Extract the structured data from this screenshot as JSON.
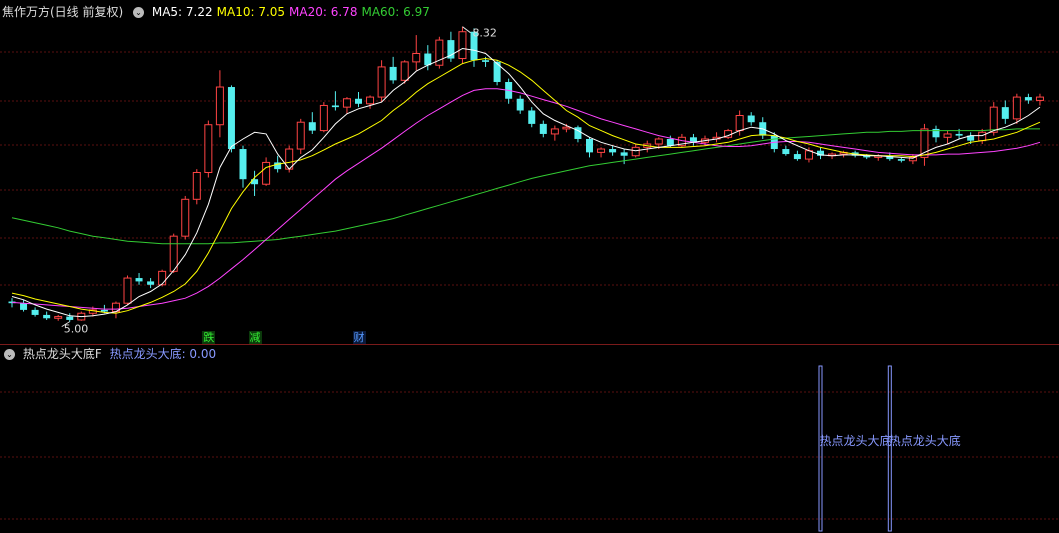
{
  "header": {
    "stock_title": "焦作万方(日线 前复权)",
    "ma_labels": [
      {
        "text": "MA5: 7.22",
        "color": "#ffffff"
      },
      {
        "text": "MA10: 7.05",
        "color": "#ffff00"
      },
      {
        "text": "MA20: 6.78",
        "color": "#ff44ff"
      },
      {
        "text": "MA60: 6.97",
        "color": "#33cc33"
      }
    ]
  },
  "price_markers": {
    "high_label": "8.32",
    "low_label": "5.00"
  },
  "signals": [
    {
      "text": "跌",
      "color": "#33ee33",
      "bg": "#0b3a0b"
    },
    {
      "text": "减",
      "color": "#33ee33",
      "bg": "#0b3a0b"
    },
    {
      "text": "财",
      "color": "#5599ff",
      "bg": "#0b1a3a"
    }
  ],
  "indicator": {
    "title": "热点龙头大底F",
    "value_label": "热点龙头大底: 0.00",
    "marker_text": "热点龙头大底",
    "color": "#8899ff"
  },
  "colors": {
    "up": "#ff4444",
    "down": "#55eeee",
    "grid": "#5a1010",
    "ma5": "#ffffff",
    "ma10": "#ffff00",
    "ma20": "#ff44ff",
    "ma60": "#33cc33"
  },
  "chart_data": {
    "type": "candlestick",
    "ylim": [
      4.9,
      8.6
    ],
    "series_ohlc": [
      [
        5.24,
        5.28,
        5.17,
        5.22
      ],
      [
        5.22,
        5.26,
        5.12,
        5.14
      ],
      [
        5.14,
        5.17,
        5.06,
        5.08
      ],
      [
        5.08,
        5.12,
        5.02,
        5.04
      ],
      [
        5.04,
        5.08,
        5.01,
        5.06
      ],
      [
        5.06,
        5.1,
        5.0,
        5.02
      ],
      [
        5.02,
        5.12,
        5.01,
        5.1
      ],
      [
        5.1,
        5.18,
        5.06,
        5.14
      ],
      [
        5.14,
        5.2,
        5.1,
        5.12
      ],
      [
        5.12,
        5.24,
        5.04,
        5.22
      ],
      [
        5.22,
        5.55,
        5.2,
        5.52
      ],
      [
        5.52,
        5.58,
        5.44,
        5.48
      ],
      [
        5.48,
        5.52,
        5.4,
        5.44
      ],
      [
        5.44,
        5.62,
        5.42,
        5.6
      ],
      [
        5.6,
        6.05,
        5.58,
        6.02
      ],
      [
        6.02,
        6.5,
        5.98,
        6.46
      ],
      [
        6.46,
        6.82,
        6.4,
        6.78
      ],
      [
        6.78,
        7.4,
        6.72,
        7.35
      ],
      [
        7.35,
        8.0,
        7.2,
        7.8
      ],
      [
        7.8,
        7.82,
        7.02,
        7.06
      ],
      [
        7.06,
        7.1,
        6.6,
        6.7
      ],
      [
        6.7,
        6.8,
        6.5,
        6.64
      ],
      [
        6.64,
        6.96,
        6.62,
        6.9
      ],
      [
        6.9,
        6.98,
        6.78,
        6.82
      ],
      [
        6.82,
        7.1,
        6.78,
        7.06
      ],
      [
        7.06,
        7.42,
        7.0,
        7.38
      ],
      [
        7.38,
        7.5,
        7.24,
        7.28
      ],
      [
        7.28,
        7.62,
        7.26,
        7.58
      ],
      [
        7.58,
        7.75,
        7.52,
        7.56
      ],
      [
        7.56,
        7.68,
        7.48,
        7.66
      ],
      [
        7.66,
        7.74,
        7.56,
        7.6
      ],
      [
        7.6,
        7.7,
        7.54,
        7.68
      ],
      [
        7.68,
        8.12,
        7.62,
        8.04
      ],
      [
        8.04,
        8.16,
        7.84,
        7.88
      ],
      [
        7.88,
        8.12,
        7.84,
        8.1
      ],
      [
        8.1,
        8.42,
        8.0,
        8.2
      ],
      [
        8.2,
        8.3,
        8.0,
        8.06
      ],
      [
        8.06,
        8.4,
        8.02,
        8.36
      ],
      [
        8.36,
        8.46,
        8.1,
        8.14
      ],
      [
        8.14,
        8.52,
        8.08,
        8.46
      ],
      [
        8.46,
        8.5,
        8.04,
        8.12
      ],
      [
        8.12,
        8.16,
        8.04,
        8.1
      ],
      [
        8.1,
        8.12,
        7.82,
        7.86
      ],
      [
        7.86,
        7.9,
        7.6,
        7.66
      ],
      [
        7.66,
        7.7,
        7.48,
        7.52
      ],
      [
        7.52,
        7.56,
        7.32,
        7.36
      ],
      [
        7.36,
        7.4,
        7.2,
        7.24
      ],
      [
        7.24,
        7.34,
        7.16,
        7.3
      ],
      [
        7.3,
        7.36,
        7.26,
        7.32
      ],
      [
        7.32,
        7.34,
        7.14,
        7.18
      ],
      [
        7.18,
        7.2,
        6.96,
        7.02
      ],
      [
        7.02,
        7.08,
        6.96,
        7.06
      ],
      [
        7.06,
        7.1,
        6.98,
        7.02
      ],
      [
        7.02,
        7.06,
        6.88,
        6.98
      ],
      [
        6.98,
        7.12,
        6.96,
        7.08
      ],
      [
        7.08,
        7.16,
        7.02,
        7.12
      ],
      [
        7.12,
        7.2,
        7.06,
        7.18
      ],
      [
        7.18,
        7.22,
        7.08,
        7.1
      ],
      [
        7.1,
        7.24,
        7.08,
        7.2
      ],
      [
        7.2,
        7.24,
        7.1,
        7.14
      ],
      [
        7.14,
        7.22,
        7.1,
        7.18
      ],
      [
        7.18,
        7.26,
        7.14,
        7.2
      ],
      [
        7.2,
        7.3,
        7.18,
        7.28
      ],
      [
        7.28,
        7.52,
        7.22,
        7.46
      ],
      [
        7.46,
        7.5,
        7.34,
        7.38
      ],
      [
        7.38,
        7.44,
        7.18,
        7.22
      ],
      [
        7.22,
        7.26,
        7.02,
        7.06
      ],
      [
        7.06,
        7.1,
        6.98,
        7.0
      ],
      [
        7.0,
        7.04,
        6.92,
        6.94
      ],
      [
        6.94,
        7.08,
        6.9,
        7.04
      ],
      [
        7.04,
        7.08,
        6.94,
        6.98
      ],
      [
        6.98,
        7.02,
        6.94,
        7.0
      ],
      [
        7.0,
        7.04,
        6.96,
        7.02
      ],
      [
        7.02,
        7.04,
        6.96,
        6.98
      ],
      [
        6.98,
        7.0,
        6.94,
        6.96
      ],
      [
        6.96,
        7.0,
        6.92,
        6.98
      ],
      [
        6.98,
        7.02,
        6.92,
        6.94
      ],
      [
        6.94,
        6.96,
        6.9,
        6.92
      ],
      [
        6.92,
        7.0,
        6.88,
        6.96
      ],
      [
        6.96,
        7.36,
        6.86,
        7.3
      ],
      [
        7.3,
        7.34,
        7.14,
        7.2
      ],
      [
        7.2,
        7.28,
        7.12,
        7.24
      ],
      [
        7.24,
        7.3,
        7.18,
        7.22
      ],
      [
        7.22,
        7.26,
        7.12,
        7.16
      ],
      [
        7.16,
        7.3,
        7.12,
        7.26
      ],
      [
        7.26,
        7.62,
        7.22,
        7.56
      ],
      [
        7.56,
        7.64,
        7.36,
        7.42
      ],
      [
        7.42,
        7.72,
        7.36,
        7.68
      ],
      [
        7.68,
        7.72,
        7.6,
        7.64
      ],
      [
        7.64,
        7.72,
        7.58,
        7.68
      ]
    ],
    "ma5": [
      5.3,
      5.26,
      5.2,
      5.15,
      5.11,
      5.07,
      5.06,
      5.07,
      5.09,
      5.12,
      5.2,
      5.3,
      5.36,
      5.45,
      5.61,
      5.8,
      6.06,
      6.4,
      6.84,
      7.09,
      7.18,
      7.26,
      7.24,
      7.0,
      6.82,
      6.96,
      7.05,
      7.2,
      7.36,
      7.48,
      7.54,
      7.58,
      7.62,
      7.76,
      7.86,
      7.99,
      8.06,
      8.12,
      8.18,
      8.26,
      8.24,
      8.2,
      8.08,
      7.96,
      7.8,
      7.62,
      7.48,
      7.4,
      7.34,
      7.28,
      7.2,
      7.14,
      7.1,
      7.06,
      7.04,
      7.06,
      7.08,
      7.1,
      7.12,
      7.14,
      7.16,
      7.18,
      7.22,
      7.28,
      7.32,
      7.3,
      7.24,
      7.16,
      7.1,
      7.04,
      6.99,
      6.98,
      6.99,
      6.99,
      6.98,
      6.98,
      6.97,
      6.96,
      6.95,
      7.02,
      7.08,
      7.12,
      7.18,
      7.22,
      7.22,
      7.28,
      7.32,
      7.38,
      7.46,
      7.56
    ],
    "ma10": [
      5.34,
      5.31,
      5.27,
      5.24,
      5.21,
      5.18,
      5.15,
      5.13,
      5.11,
      5.1,
      5.13,
      5.18,
      5.23,
      5.29,
      5.36,
      5.45,
      5.6,
      5.82,
      6.08,
      6.35,
      6.55,
      6.72,
      6.84,
      6.88,
      6.9,
      6.93,
      6.98,
      7.05,
      7.12,
      7.18,
      7.24,
      7.32,
      7.4,
      7.52,
      7.62,
      7.74,
      7.84,
      7.92,
      8.0,
      8.08,
      8.12,
      8.14,
      8.12,
      8.06,
      7.98,
      7.88,
      7.76,
      7.64,
      7.52,
      7.44,
      7.34,
      7.28,
      7.22,
      7.17,
      7.12,
      7.1,
      7.08,
      7.08,
      7.08,
      7.09,
      7.1,
      7.12,
      7.14,
      7.18,
      7.22,
      7.23,
      7.22,
      7.19,
      7.15,
      7.12,
      7.08,
      7.05,
      7.02,
      7.0,
      6.99,
      6.98,
      6.98,
      6.98,
      6.97,
      6.99,
      7.02,
      7.06,
      7.1,
      7.14,
      7.16,
      7.18,
      7.22,
      7.26,
      7.32,
      7.38
    ],
    "ma20": [
      5.23,
      5.22,
      5.21,
      5.2,
      5.19,
      5.18,
      5.17,
      5.16,
      5.15,
      5.15,
      5.16,
      5.18,
      5.2,
      5.22,
      5.25,
      5.28,
      5.34,
      5.42,
      5.52,
      5.63,
      5.74,
      5.86,
      5.98,
      6.1,
      6.22,
      6.34,
      6.46,
      6.58,
      6.7,
      6.8,
      6.89,
      6.98,
      7.07,
      7.17,
      7.27,
      7.37,
      7.46,
      7.54,
      7.62,
      7.7,
      7.76,
      7.78,
      7.78,
      7.76,
      7.73,
      7.69,
      7.65,
      7.61,
      7.57,
      7.52,
      7.47,
      7.42,
      7.38,
      7.34,
      7.3,
      7.26,
      7.22,
      7.19,
      7.16,
      7.14,
      7.12,
      7.1,
      7.09,
      7.09,
      7.1,
      7.12,
      7.14,
      7.15,
      7.15,
      7.14,
      7.12,
      7.1,
      7.08,
      7.06,
      7.04,
      7.02,
      7.01,
      7.0,
      6.99,
      6.99,
      6.99,
      7.0,
      7.0,
      7.01,
      7.02,
      7.03,
      7.05,
      7.07,
      7.1,
      7.14
    ],
    "ma60": [
      6.24,
      6.21,
      6.18,
      6.15,
      6.12,
      6.08,
      6.05,
      6.02,
      6.0,
      5.98,
      5.96,
      5.95,
      5.94,
      5.93,
      5.93,
      5.93,
      5.93,
      5.93,
      5.94,
      5.94,
      5.95,
      5.96,
      5.97,
      5.98,
      6.0,
      6.02,
      6.04,
      6.06,
      6.08,
      6.11,
      6.14,
      6.17,
      6.2,
      6.23,
      6.27,
      6.31,
      6.35,
      6.39,
      6.43,
      6.47,
      6.51,
      6.55,
      6.59,
      6.63,
      6.67,
      6.71,
      6.74,
      6.77,
      6.8,
      6.83,
      6.86,
      6.88,
      6.9,
      6.92,
      6.94,
      6.96,
      6.98,
      7.0,
      7.02,
      7.04,
      7.06,
      7.08,
      7.1,
      7.12,
      7.14,
      7.16,
      7.18,
      7.19,
      7.2,
      7.21,
      7.22,
      7.23,
      7.24,
      7.25,
      7.26,
      7.26,
      7.27,
      7.27,
      7.28,
      7.28,
      7.28,
      7.28,
      7.28,
      7.28,
      7.28,
      7.29,
      7.29,
      7.3,
      7.3,
      7.3
    ],
    "signal_indices": [
      17,
      21,
      30
    ],
    "indicator_bar_indices": [
      70,
      76
    ]
  }
}
